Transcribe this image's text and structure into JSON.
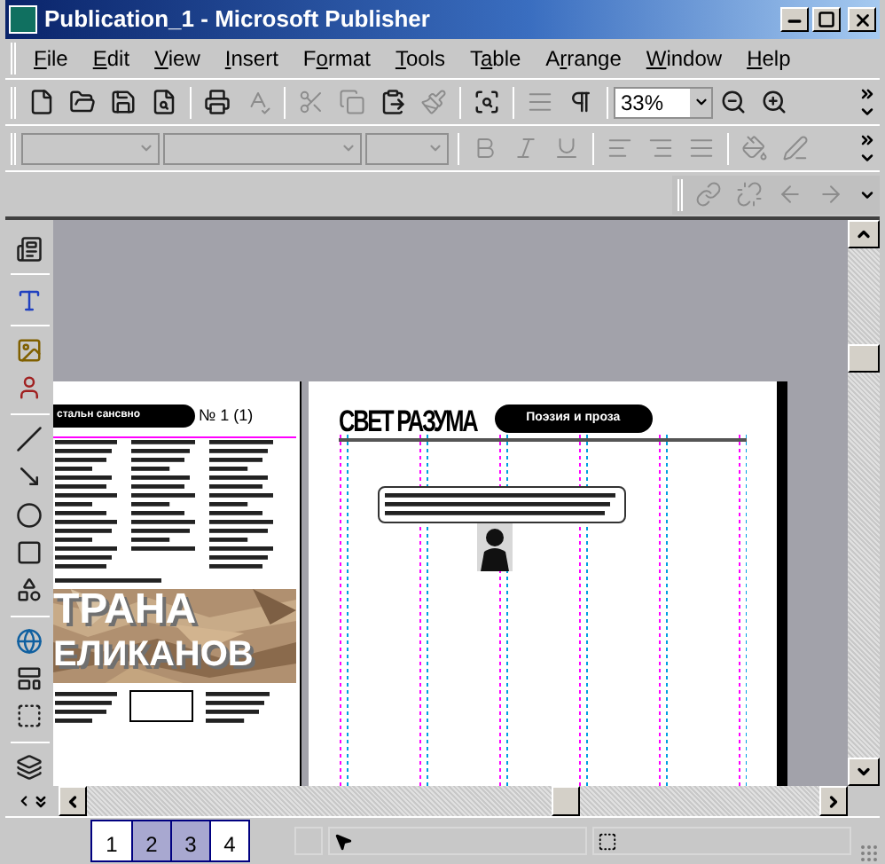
{
  "window": {
    "title": "Publication_1 - Microsoft Publisher"
  },
  "menu": [
    {
      "key": "F",
      "rest": "ile"
    },
    {
      "key": "E",
      "rest": "dit"
    },
    {
      "key": "V",
      "rest": "iew"
    },
    {
      "key": "I",
      "rest": "nsert"
    },
    {
      "pre": "F",
      "key": "o",
      "rest": "rmat"
    },
    {
      "key": "T",
      "rest": "ools"
    },
    {
      "pre": "T",
      "key": "a",
      "rest": "ble"
    },
    {
      "pre": "A",
      "key": "r",
      "rest": "range"
    },
    {
      "key": "W",
      "rest": "indow"
    },
    {
      "key": "H",
      "rest": "elp"
    }
  ],
  "standard_toolbar": [
    {
      "kind": "new",
      "disabled": false
    },
    {
      "kind": "open",
      "disabled": false
    },
    {
      "kind": "save",
      "disabled": false
    },
    {
      "kind": "preview",
      "disabled": false
    },
    {
      "kind": "sep"
    },
    {
      "kind": "print",
      "disabled": false
    },
    {
      "kind": "spelling",
      "disabled": true
    },
    {
      "kind": "sep"
    },
    {
      "kind": "cut",
      "disabled": true
    },
    {
      "kind": "copy",
      "disabled": true
    },
    {
      "kind": "paste",
      "disabled": false
    },
    {
      "kind": "painter",
      "disabled": true
    },
    {
      "kind": "sep"
    },
    {
      "kind": "web_preview",
      "disabled": false
    },
    {
      "kind": "sep"
    },
    {
      "kind": "columns",
      "disabled": true
    },
    {
      "kind": "pilcrow",
      "disabled": false
    },
    {
      "kind": "sep"
    },
    {
      "kind": "zoom",
      "value": "33%"
    },
    {
      "kind": "zoom_out",
      "disabled": false
    },
    {
      "kind": "zoom_in",
      "disabled": false
    }
  ],
  "formatting_toolbar": [
    {
      "kind": "combo",
      "disabled": true
    },
    {
      "kind": "combo_wide",
      "disabled": true
    },
    {
      "kind": "combo_small",
      "disabled": true
    },
    {
      "kind": "sep"
    },
    {
      "kind": "bold",
      "disabled": true
    },
    {
      "kind": "italic",
      "disabled": true
    },
    {
      "kind": "underline",
      "disabled": true
    },
    {
      "kind": "sep"
    },
    {
      "kind": "align_left",
      "disabled": true
    },
    {
      "kind": "align_right",
      "disabled": true
    },
    {
      "kind": "justify",
      "disabled": true
    },
    {
      "kind": "sep"
    },
    {
      "kind": "fill",
      "disabled": true
    },
    {
      "kind": "line_color",
      "disabled": true
    }
  ],
  "connect_toolbar": [
    {
      "kind": "link",
      "disabled": true
    },
    {
      "kind": "unlink",
      "disabled": true
    },
    {
      "kind": "flow_back",
      "disabled": true
    },
    {
      "kind": "flow_next",
      "disabled": true
    }
  ],
  "objects_toolbar": [
    {
      "kind": "text_box"
    },
    {
      "kind": "sep"
    },
    {
      "kind": "wordart"
    },
    {
      "kind": "sep"
    },
    {
      "kind": "picture"
    },
    {
      "kind": "clipart"
    },
    {
      "kind": "sep"
    },
    {
      "kind": "line"
    },
    {
      "kind": "arrow"
    },
    {
      "kind": "oval"
    },
    {
      "kind": "rectangle"
    },
    {
      "kind": "shapes"
    },
    {
      "kind": "sep"
    },
    {
      "kind": "web"
    },
    {
      "kind": "form"
    },
    {
      "kind": "hotspot"
    },
    {
      "kind": "sep"
    },
    {
      "kind": "gallery"
    }
  ],
  "publication": {
    "left_page": {
      "banner": "стальн сансвно",
      "issue": "№ 1 (1)",
      "headline": [
        "ТРАНА",
        "ЕЛИКАНОВ"
      ]
    },
    "right_page": {
      "masthead": "СВЕТ РАЗУМА",
      "banner": "Поэзия и проза"
    }
  },
  "page_tabs": [
    {
      "label": "1",
      "selected": false
    },
    {
      "label": "2",
      "selected": true
    },
    {
      "label": "3",
      "selected": true
    },
    {
      "label": "4",
      "selected": false
    }
  ]
}
